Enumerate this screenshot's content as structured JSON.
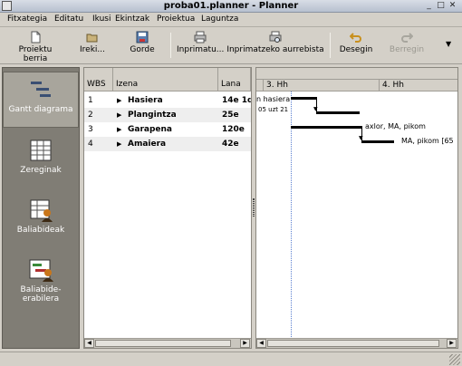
{
  "window": {
    "title": "proba01.planner - Planner"
  },
  "menu": [
    "Fitxategia",
    "Editatu",
    "Ikusi",
    "Ekintzak",
    "Proiektua",
    "Laguntza"
  ],
  "toolbar": {
    "new_project": "Proiektu berria",
    "open": "Ireki...",
    "save": "Gorde",
    "print": "Inprimatu...",
    "print_preview": "Inprimatzeko aurrebista",
    "undo": "Desegin",
    "redo": "Berregin"
  },
  "sidebar": [
    {
      "label": "Gantt diagrama",
      "icon": "gantt-icon",
      "active": true
    },
    {
      "label": "Zereginak",
      "icon": "tasks-icon",
      "active": false
    },
    {
      "label": "Baliabideak",
      "icon": "resources-icon",
      "active": false
    },
    {
      "label": "Baliabide-erabilera",
      "icon": "resource-usage-icon",
      "active": false
    }
  ],
  "table": {
    "headers": {
      "wbs": "WBS",
      "name": "Izena",
      "work": "Lana"
    },
    "rows": [
      {
        "wbs": "1",
        "name": "Hasiera",
        "work": "14e 1d"
      },
      {
        "wbs": "2",
        "name": "Plangintza",
        "work": "25e"
      },
      {
        "wbs": "3",
        "name": "Garapena",
        "work": "120e"
      },
      {
        "wbs": "4",
        "name": "Amaiera",
        "work": "42e"
      }
    ]
  },
  "gantt": {
    "weeks": [
      "3. Hh",
      "4. Hh"
    ],
    "start_label_1": "n hasiera",
    "start_label_2": "05 uzt 21",
    "bar3_label": "axlor, MA, pikom",
    "bar4_label": "MA, pikom [65"
  }
}
